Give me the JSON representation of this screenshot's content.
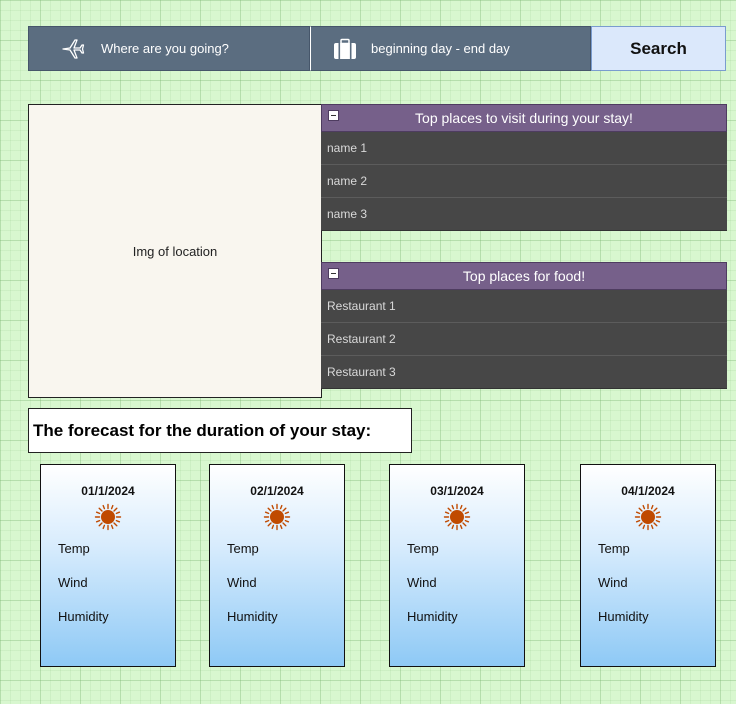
{
  "search": {
    "destination_placeholder": "Where are you going?",
    "destination_icon": "airplane-icon",
    "dates_placeholder": "beginning day - end day",
    "dates_icon": "suitcase-icon",
    "button_label": "Search"
  },
  "location": {
    "image_label": "Img of location"
  },
  "places": {
    "title": "Top places to visit during your stay!",
    "items": [
      "name 1",
      "name 2",
      "name 3"
    ]
  },
  "food": {
    "title": "Top places for food!",
    "items": [
      "Restaurant 1",
      "Restaurant  2",
      "Restaurant 3"
    ]
  },
  "forecast": {
    "title": "The forecast for the duration of your stay:",
    "days": [
      {
        "date": "01/1/2024",
        "icon": "sun-icon",
        "temp_label": "Temp",
        "wind_label": "Wind",
        "humidity_label": "Humidity"
      },
      {
        "date": "02/1/2024",
        "icon": "sun-icon",
        "temp_label": "Temp",
        "wind_label": "Wind",
        "humidity_label": "Humidity"
      },
      {
        "date": "03/1/2024",
        "icon": "sun-icon",
        "temp_label": "Temp",
        "wind_label": "Wind",
        "humidity_label": "Humidity"
      },
      {
        "date": "04/1/2024",
        "icon": "sun-icon",
        "temp_label": "Temp",
        "wind_label": "Wind",
        "humidity_label": "Humidity"
      }
    ]
  },
  "colors": {
    "canvas_background": "#d8f7cf",
    "field_background": "#5b6d80",
    "search_button": "#dbe8fb",
    "panel_header": "#76608a",
    "panel_item": "#474747",
    "sun": "#c04a00"
  }
}
